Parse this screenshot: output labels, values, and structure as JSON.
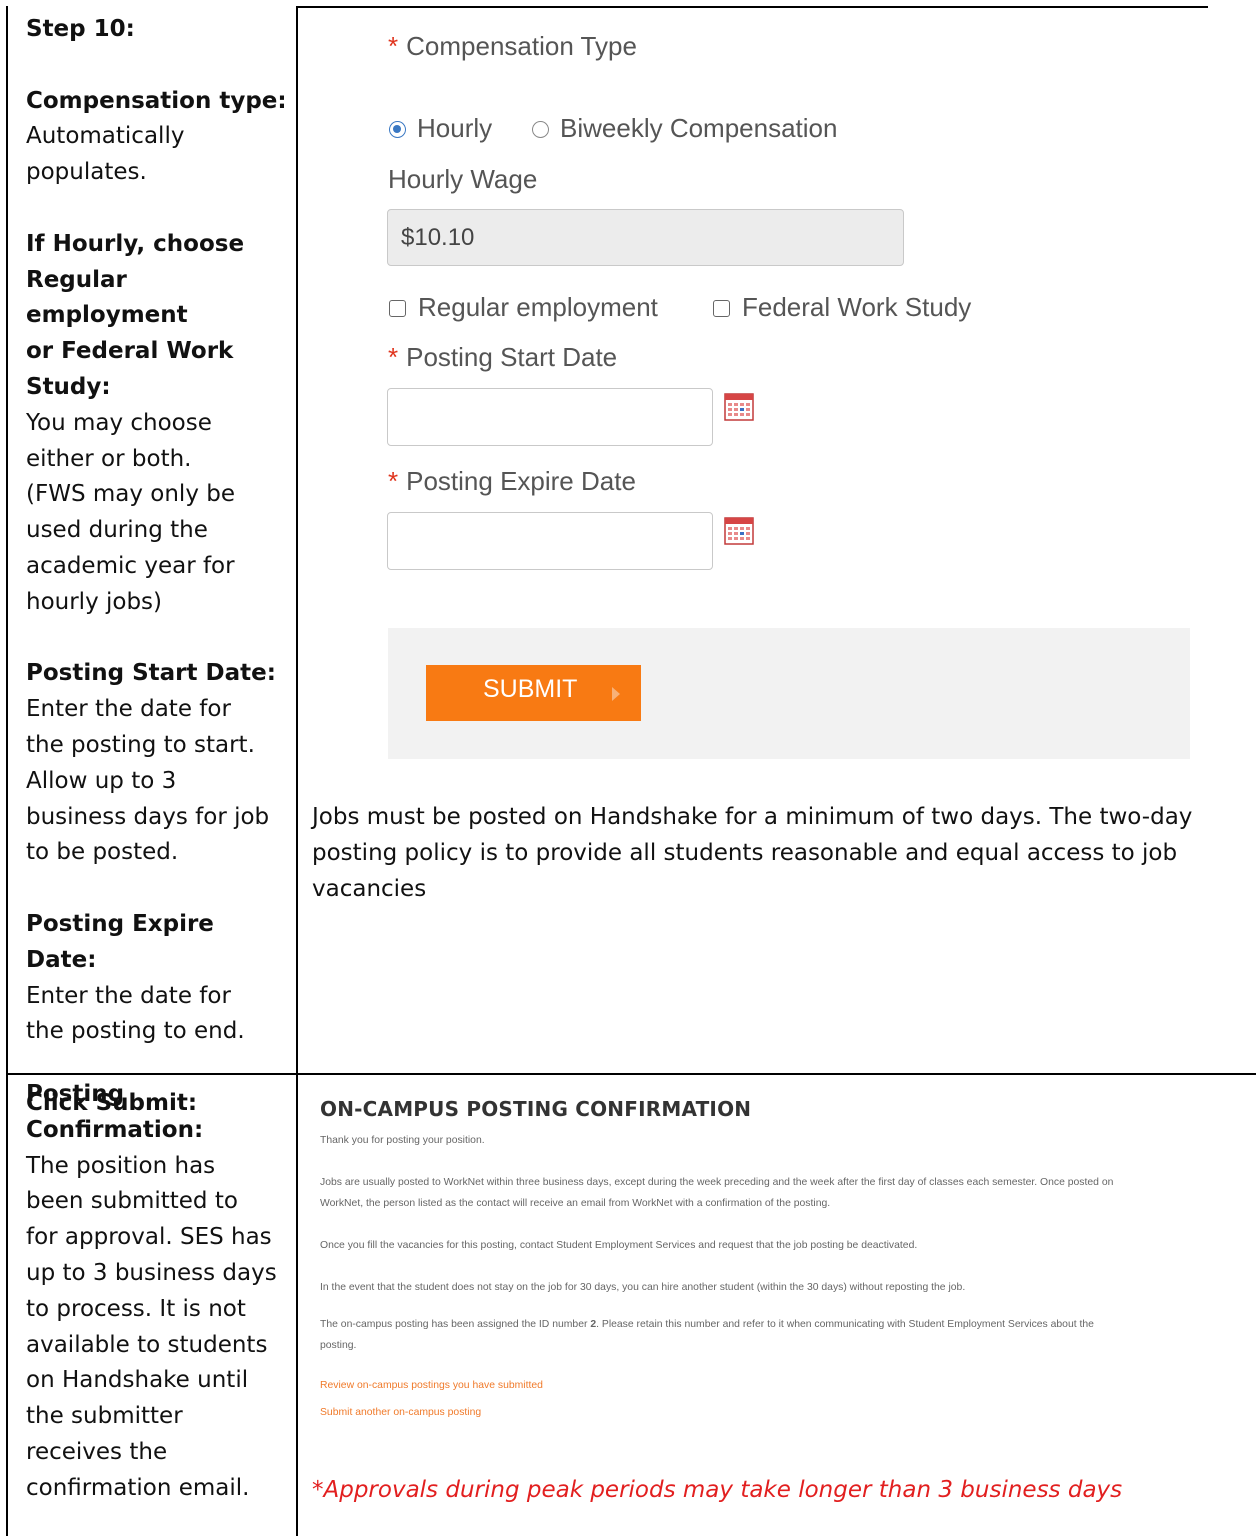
{
  "instructions_row1": {
    "step": "Step 10:",
    "compensation_heading": "Compensation type:",
    "compensation_lines": [
      "Automatically",
      "populates."
    ],
    "hourly_heading_lines": [
      "If Hourly, choose",
      "Regular employment",
      "or Federal Work",
      "Study:"
    ],
    "hourly_lines": [
      "You may choose",
      "either or both.",
      "(FWS may only be",
      "used during the",
      "academic year for",
      "hourly jobs)"
    ],
    "start_heading": "Posting Start Date:",
    "start_lines": [
      "Enter the date for",
      "the posting to start.",
      "Allow up to 3",
      "business days for job",
      "to be posted."
    ],
    "expire_heading": "Posting Expire Date:",
    "expire_lines": [
      "Enter the date for",
      "the posting to end."
    ],
    "submit_heading": "Click Submit:"
  },
  "form": {
    "compensation_type_label": "Compensation Type",
    "required_mark": "*",
    "options": [
      {
        "label": "Hourly",
        "selected": true
      },
      {
        "label": "Biweekly Compensation",
        "selected": false
      }
    ],
    "hourly_wage_label": "Hourly Wage",
    "hourly_wage_value": "$10.10",
    "checkboxes": [
      {
        "label": "Regular employment",
        "checked": false
      },
      {
        "label": "Federal Work Study",
        "checked": false
      }
    ],
    "start_date_label": "Posting Start Date",
    "start_date_value": "",
    "expire_date_label": "Posting Expire Date",
    "expire_date_value": "",
    "calendar_icon": "calendar-icon",
    "submit_label": "SUBMIT",
    "submit_color": "#f87a13",
    "policy_note_lines": [
      "Jobs must be posted on Handshake for a minimum of two days. The two-day",
      "posting policy is to provide all students reasonable and equal access to job",
      "vacancies"
    ]
  },
  "instructions_row2": {
    "heading_lines": [
      "Posting",
      "Confirmation:"
    ],
    "body_lines": [
      "The position has",
      "been submitted to",
      "for approval. SES has",
      "up to 3 business days",
      "to process. It is not",
      "available to students",
      "on Handshake until",
      "the submitter",
      "receives the",
      "confirmation email."
    ]
  },
  "confirmation": {
    "title": "ON-CAMPUS POSTING CONFIRMATION",
    "thanks": "Thank you for posting your position.",
    "para1_lines": [
      "Jobs are usually posted to WorkNet within three business days, except during the week preceding and the week after the first day of classes each semester. Once posted on",
      "WorkNet, the person listed as the contact will receive an email from WorkNet with a confirmation of the posting."
    ],
    "para2": "Once you fill the vacancies for this posting, contact Student Employment Services and request that the job posting be deactivated.",
    "para3": "In the event that the student does not stay on the job for 30 days, you can hire another student (within the 30 days) without reposting the job.",
    "para4_before": "The on-campus posting has been assigned the ID number ",
    "para4_id": "2",
    "para4_after": ". Please retain this number and refer to it when communicating with Student Employment Services about the",
    "para4_line2": "posting.",
    "link_review": "Review on-campus postings you have submitted",
    "link_submit_another": "Submit another on-campus posting",
    "link_color": "#f07a2a",
    "peak_note": "*Approvals during peak periods may take longer than 3 business days",
    "peak_note_color": "#e21f1f"
  }
}
